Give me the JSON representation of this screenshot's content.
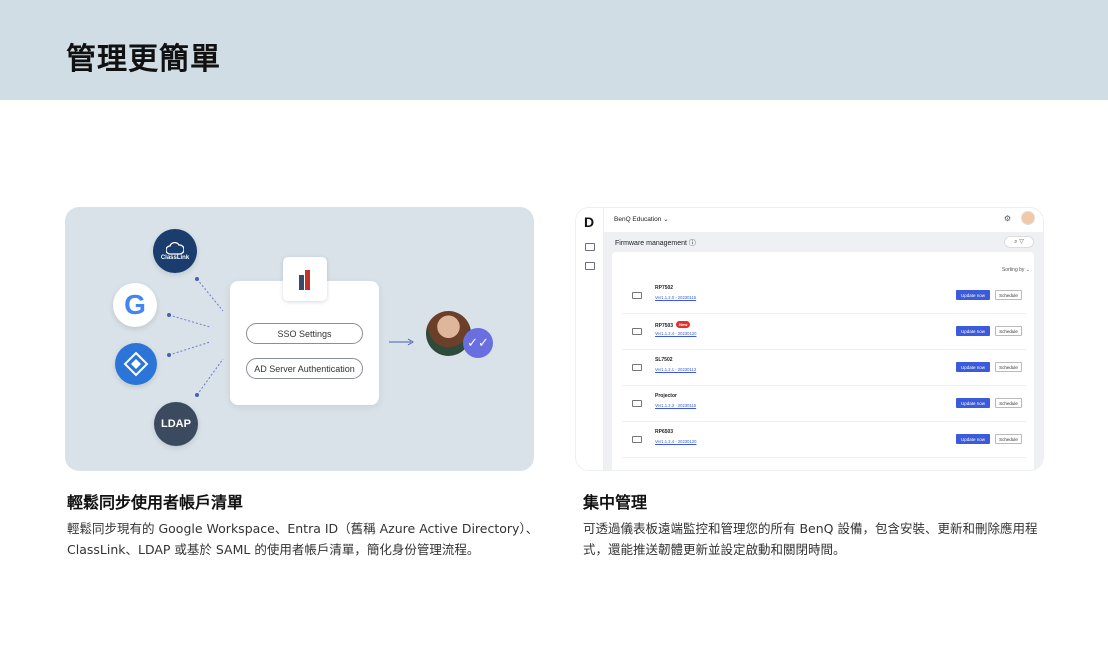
{
  "banner": {
    "title": "管理更簡單"
  },
  "left_illustration": {
    "classlink_label": "ClassLink",
    "ldap_label": "LDAP",
    "google_glyph": "G",
    "sso_label": "SSO Settings",
    "ad_label": "AD Server Authentication",
    "icons": [
      "classlink-icon",
      "google-icon",
      "entra-id-icon",
      "ldap-icon",
      "app-logo-icon",
      "user-avatar",
      "verified-check-icon"
    ]
  },
  "right_screenshot": {
    "org": "BenQ Education",
    "page_title": "Firmware management",
    "sorting": "Sorting by",
    "devices": [
      {
        "name": "RP7502",
        "version": "Ver1.1.2.0 - 20230115",
        "badge": ""
      },
      {
        "name": "RP7503",
        "version": "Ver1.1.2.4 - 20230120",
        "badge": "New"
      },
      {
        "name": "SL7502",
        "version": "Ver1.1.2.1 - 20230113",
        "badge": ""
      },
      {
        "name": "Projector",
        "version": "Ver1.1.2.3 - 20230115",
        "badge": ""
      },
      {
        "name": "RP6503",
        "version": "Ver1.1.2.4 - 20230120",
        "badge": ""
      }
    ],
    "update_label": "Update now",
    "schedule_label": "Schedule",
    "colors": {
      "accent": "#3b5bdb",
      "badge": "#e03131"
    }
  },
  "left_section": {
    "heading": "輕鬆同步使用者帳戶清單",
    "body": "輕鬆同步現有的 Google Workspace、Entra ID（舊稱 Azure Active Directory）、ClassLink、LDAP 或基於 SAML 的使用者帳戶清單，簡化身份管理流程。"
  },
  "right_section": {
    "heading": "集中管理",
    "body": "可透過儀表板遠端監控和管理您的所有 BenQ 設備，包含安裝、更新和刪除應用程式，還能推送韌體更新並設定啟動和關閉時間。"
  }
}
